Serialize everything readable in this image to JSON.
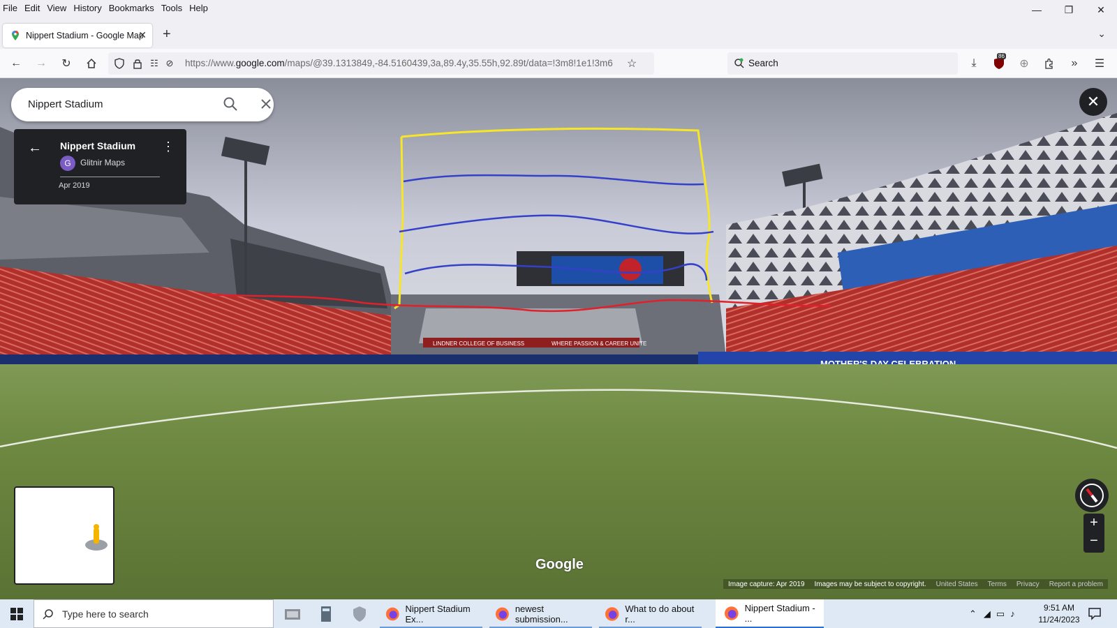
{
  "menu": [
    "File",
    "Edit",
    "View",
    "History",
    "Bookmarks",
    "Tools",
    "Help"
  ],
  "tab": {
    "title": "Nippert Stadium - Google Maps",
    "close": "✕"
  },
  "new_tab": "+",
  "url": {
    "prefix": "https://www.",
    "domain": "google.com",
    "rest": "/maps/@39.1313849,-84.5160439,3a,89.4y,35.55h,92.89t/data=!3m8!1e1!3m6"
  },
  "browser_search_placeholder": "Search",
  "extension_badge": "86",
  "maps": {
    "search_query": "Nippert Stadium",
    "place": {
      "title": "Nippert Stadium",
      "author_initial": "G",
      "author": "Glitnir Maps",
      "date": "Apr 2019"
    },
    "google_logo": "Google",
    "footer": [
      "Image capture: Apr 2019",
      "Images may be subject to copyright.",
      "United States",
      "Terms",
      "Privacy",
      "Report a problem"
    ],
    "banners": [
      "MOTHER'S DAY CELEBRATION",
      "LINDNER COLLEGE OF BUSINESS",
      "WHERE PASSION & CAREER UNITE"
    ]
  },
  "colors": {
    "annotation_yellow": "#f7e52a",
    "annotation_blue": "#3440c8",
    "annotation_red": "#e0202a"
  },
  "taskbar": {
    "search_placeholder": "Type here to search",
    "apps": [
      "Nippert Stadium Ex...",
      "newest submission...",
      "What to do about r...",
      "Nippert Stadium - ..."
    ],
    "time": "9:51 AM",
    "date": "11/24/2023"
  }
}
